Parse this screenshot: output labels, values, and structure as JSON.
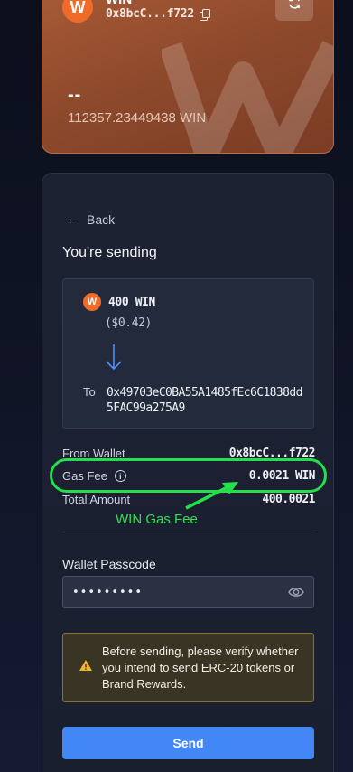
{
  "wallet": {
    "name": "WIN",
    "address": "0x8bcC...f722",
    "balance_fiat": "--",
    "balance_token": "112357.23449438 WIN",
    "logo_letter": "W",
    "icons": [
      "copy-icon",
      "refresh-icon"
    ]
  },
  "send": {
    "back_label": "Back",
    "title": "You're sending",
    "token_logo_letter": "W",
    "amount": "400 WIN",
    "amount_fiat": "($0.42)",
    "to_label": "To",
    "to_address": "0x49703eC0BA55A1485fEc6C1838dd5FAC99a275A9"
  },
  "details": {
    "from_wallet_label": "From Wallet",
    "from_wallet_value": "0x8bcC...f722",
    "gas_fee_label": "Gas Fee",
    "gas_fee_value": "0.0021 WIN",
    "total_label": "Total Amount",
    "total_value": "400.0021"
  },
  "passcode": {
    "label": "Wallet Passcode",
    "value": "•••••••••"
  },
  "warning": {
    "text": "Before sending, please verify whether you intend to send ERC-20 tokens or Brand Rewards."
  },
  "actions": {
    "send_label": "Send"
  },
  "annotation": {
    "label": "WIN Gas Fee",
    "color": "#22e04a"
  },
  "colors": {
    "accent": "#4287f5",
    "brand": "#f06a2a",
    "warning_border": "#8a7230"
  }
}
